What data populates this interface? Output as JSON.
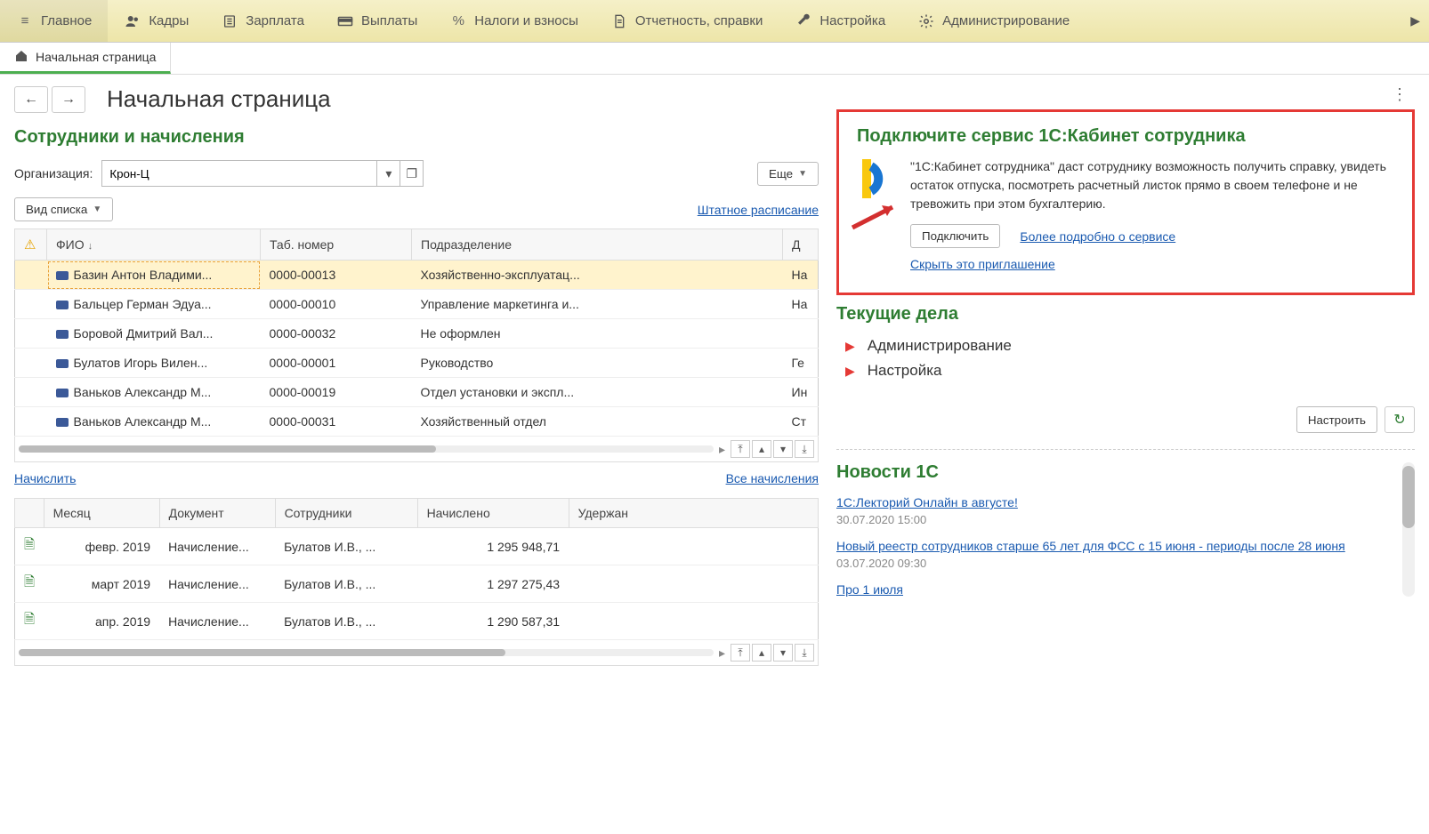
{
  "toolbar": {
    "items": [
      {
        "label": "Главное",
        "icon": "menu"
      },
      {
        "label": "Кадры",
        "icon": "people"
      },
      {
        "label": "Зарплата",
        "icon": "calc"
      },
      {
        "label": "Выплаты",
        "icon": "money"
      },
      {
        "label": "Налоги и взносы",
        "icon": "percent"
      },
      {
        "label": "Отчетность, справки",
        "icon": "doc"
      },
      {
        "label": "Настройка",
        "icon": "wrench"
      },
      {
        "label": "Администрирование",
        "icon": "gear"
      }
    ]
  },
  "tabs": {
    "home": "Начальная страница"
  },
  "page": {
    "title": "Начальная страница"
  },
  "employees": {
    "section_title": "Сотрудники и начисления",
    "org_label": "Организация:",
    "org_value": "Крон-Ц",
    "more_btn": "Еще",
    "list_view_btn": "Вид списка",
    "staff_link": "Штатное расписание",
    "columns": {
      "warn": "",
      "fio": "ФИО",
      "tab": "Таб. номер",
      "dept": "Подразделение",
      "d": "Д"
    },
    "rows": [
      {
        "fio": "Базин Антон Владими...",
        "tab": "0000-00013",
        "dept": "Хозяйственно-эксплуатац...",
        "d": "На",
        "selected": true
      },
      {
        "fio": "Бальцер Герман Эдуа...",
        "tab": "0000-00010",
        "dept": "Управление маркетинга и...",
        "d": "На"
      },
      {
        "fio": "Боровой Дмитрий Вал...",
        "tab": "0000-00032",
        "dept": "Не оформлен",
        "d": "",
        "dept_red": true
      },
      {
        "fio": "Булатов Игорь Вилен...",
        "tab": "0000-00001",
        "dept": "Руководство",
        "d": "Ге"
      },
      {
        "fio": "Ваньков Александр М...",
        "tab": "0000-00019",
        "dept": "Отдел установки и экспл...",
        "d": "Ин"
      },
      {
        "fio": "Ваньков Александр М...",
        "tab": "0000-00031",
        "dept": "Хозяйственный отдел",
        "d": "Ст"
      }
    ],
    "accrue_link": "Начислить",
    "all_accruals_link": "Все начисления"
  },
  "accruals": {
    "columns": {
      "month": "Месяц",
      "doc": "Документ",
      "emp": "Сотрудники",
      "amount": "Начислено",
      "held": "Удержан"
    },
    "rows": [
      {
        "month": "февр. 2019",
        "doc": "Начисление...",
        "emp": "Булатов И.В., ...",
        "amount": "1 295 948,71"
      },
      {
        "month": "март 2019",
        "doc": "Начисление...",
        "emp": "Булатов И.В., ...",
        "amount": "1 297 275,43"
      },
      {
        "month": "апр. 2019",
        "doc": "Начисление...",
        "emp": "Булатов И.В., ...",
        "amount": "1 290 587,31"
      }
    ]
  },
  "promo": {
    "title": "Подключите сервис 1С:Кабинет сотрудника",
    "text": "\"1С:Кабинет сотрудника\" даст сотруднику возможность получить справку, увидеть остаток отпуска, посмотреть расчетный листок прямо в своем телефоне и не тревожить при этом бухгалтерию.",
    "connect_btn": "Подключить",
    "more_link": "Более подробно о сервисе",
    "hide_link": "Скрыть это приглашение"
  },
  "todos": {
    "title": "Текущие дела",
    "items": [
      "Администрирование",
      "Настройка"
    ],
    "config_btn": "Настроить"
  },
  "news": {
    "title": "Новости 1С",
    "items": [
      {
        "link": "1С:Лекторий Онлайн в августе!",
        "date": "30.07.2020 15:00"
      },
      {
        "link": "Новый реестр сотрудников старше 65 лет для ФСС с 15 июня - периоды после 28 июня",
        "date": "03.07.2020 09:30"
      },
      {
        "link": "Про 1 июля",
        "date": ""
      }
    ]
  }
}
